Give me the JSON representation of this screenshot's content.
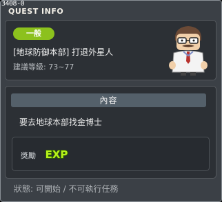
{
  "header": {
    "quest_id": "3408-0",
    "title": "QUEST INFO"
  },
  "quest": {
    "category_badge": "一般",
    "name": "[地球防御本部] 打退外星人",
    "recommended_level": "建議等級: 73~77",
    "npc_icon": "scientist-npc-portrait"
  },
  "content": {
    "section_title": "內容",
    "description": "要去地球本部找金博士",
    "reward_label": "獎勵",
    "reward_icon": "exp-icon",
    "reward_icon_text": "EXP"
  },
  "status": {
    "text": "狀態: 可開始 / 不可執行任務"
  },
  "colors": {
    "badge": "#8cc11d",
    "exp_fill": "#b6f21a"
  }
}
